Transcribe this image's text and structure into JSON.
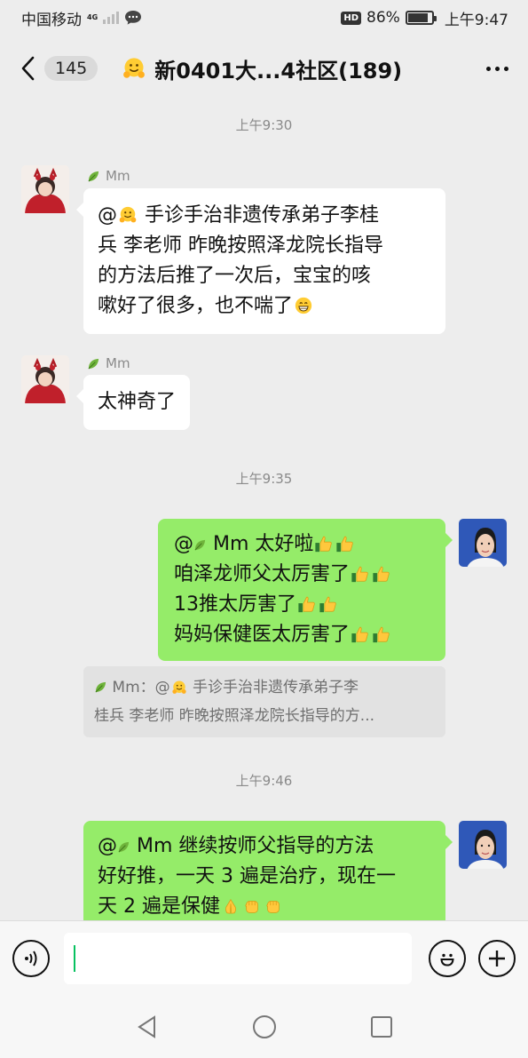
{
  "status_bar": {
    "carrier": "中国移动",
    "network": "4G",
    "hd": "HD",
    "battery": "86%",
    "battery_level": 0.86,
    "time": "上午9:47"
  },
  "header": {
    "unread_count": "145",
    "title": "新0401大...4社区(189)"
  },
  "messages": [
    {
      "timestamp": "上午9:30"
    },
    {
      "sender": "Mm",
      "lines": [
        "@",
        "手诊手治非遗传承弟子李桂",
        "兵 李老师 昨晚按照泽龙院长指导",
        "的方法后推了一次后，宝宝的咳",
        "嗽好了很多，也不喘了"
      ]
    },
    {
      "sender": "Mm",
      "text": "太神奇了"
    },
    {
      "timestamp": "上午9:35"
    },
    {
      "lines": [
        "@",
        "Mm 太好啦",
        "咱泽龙师父太厉害了",
        "13推太厉害了",
        "妈妈保健医太厉害了"
      ],
      "quote": {
        "sender": "Mm：@",
        "lines": [
          "手诊手治非遗传承弟子李",
          "桂兵 李老师 昨晚按照泽龙院长指导的方..."
        ]
      }
    },
    {
      "timestamp": "上午9:46"
    },
    {
      "lines": [
        "@",
        "Mm  继续按师父指导的方法",
        "好好推，一天 3 遍是治疗，现在一",
        "天 2 遍是保健"
      ]
    }
  ],
  "input": {
    "value": ""
  },
  "icons": {
    "back": "chevron-left-icon",
    "more": "more-icon",
    "voice": "voice-icon",
    "emoji": "emoji-icon",
    "plus": "plus-icon",
    "nav_back": "nav-back-icon",
    "nav_home": "nav-home-icon",
    "nav_recent": "nav-recent-icon"
  },
  "colors": {
    "background": "#ededed",
    "own_bubble": "#95ec69",
    "other_bubble": "#ffffff",
    "accent": "#07c160"
  }
}
